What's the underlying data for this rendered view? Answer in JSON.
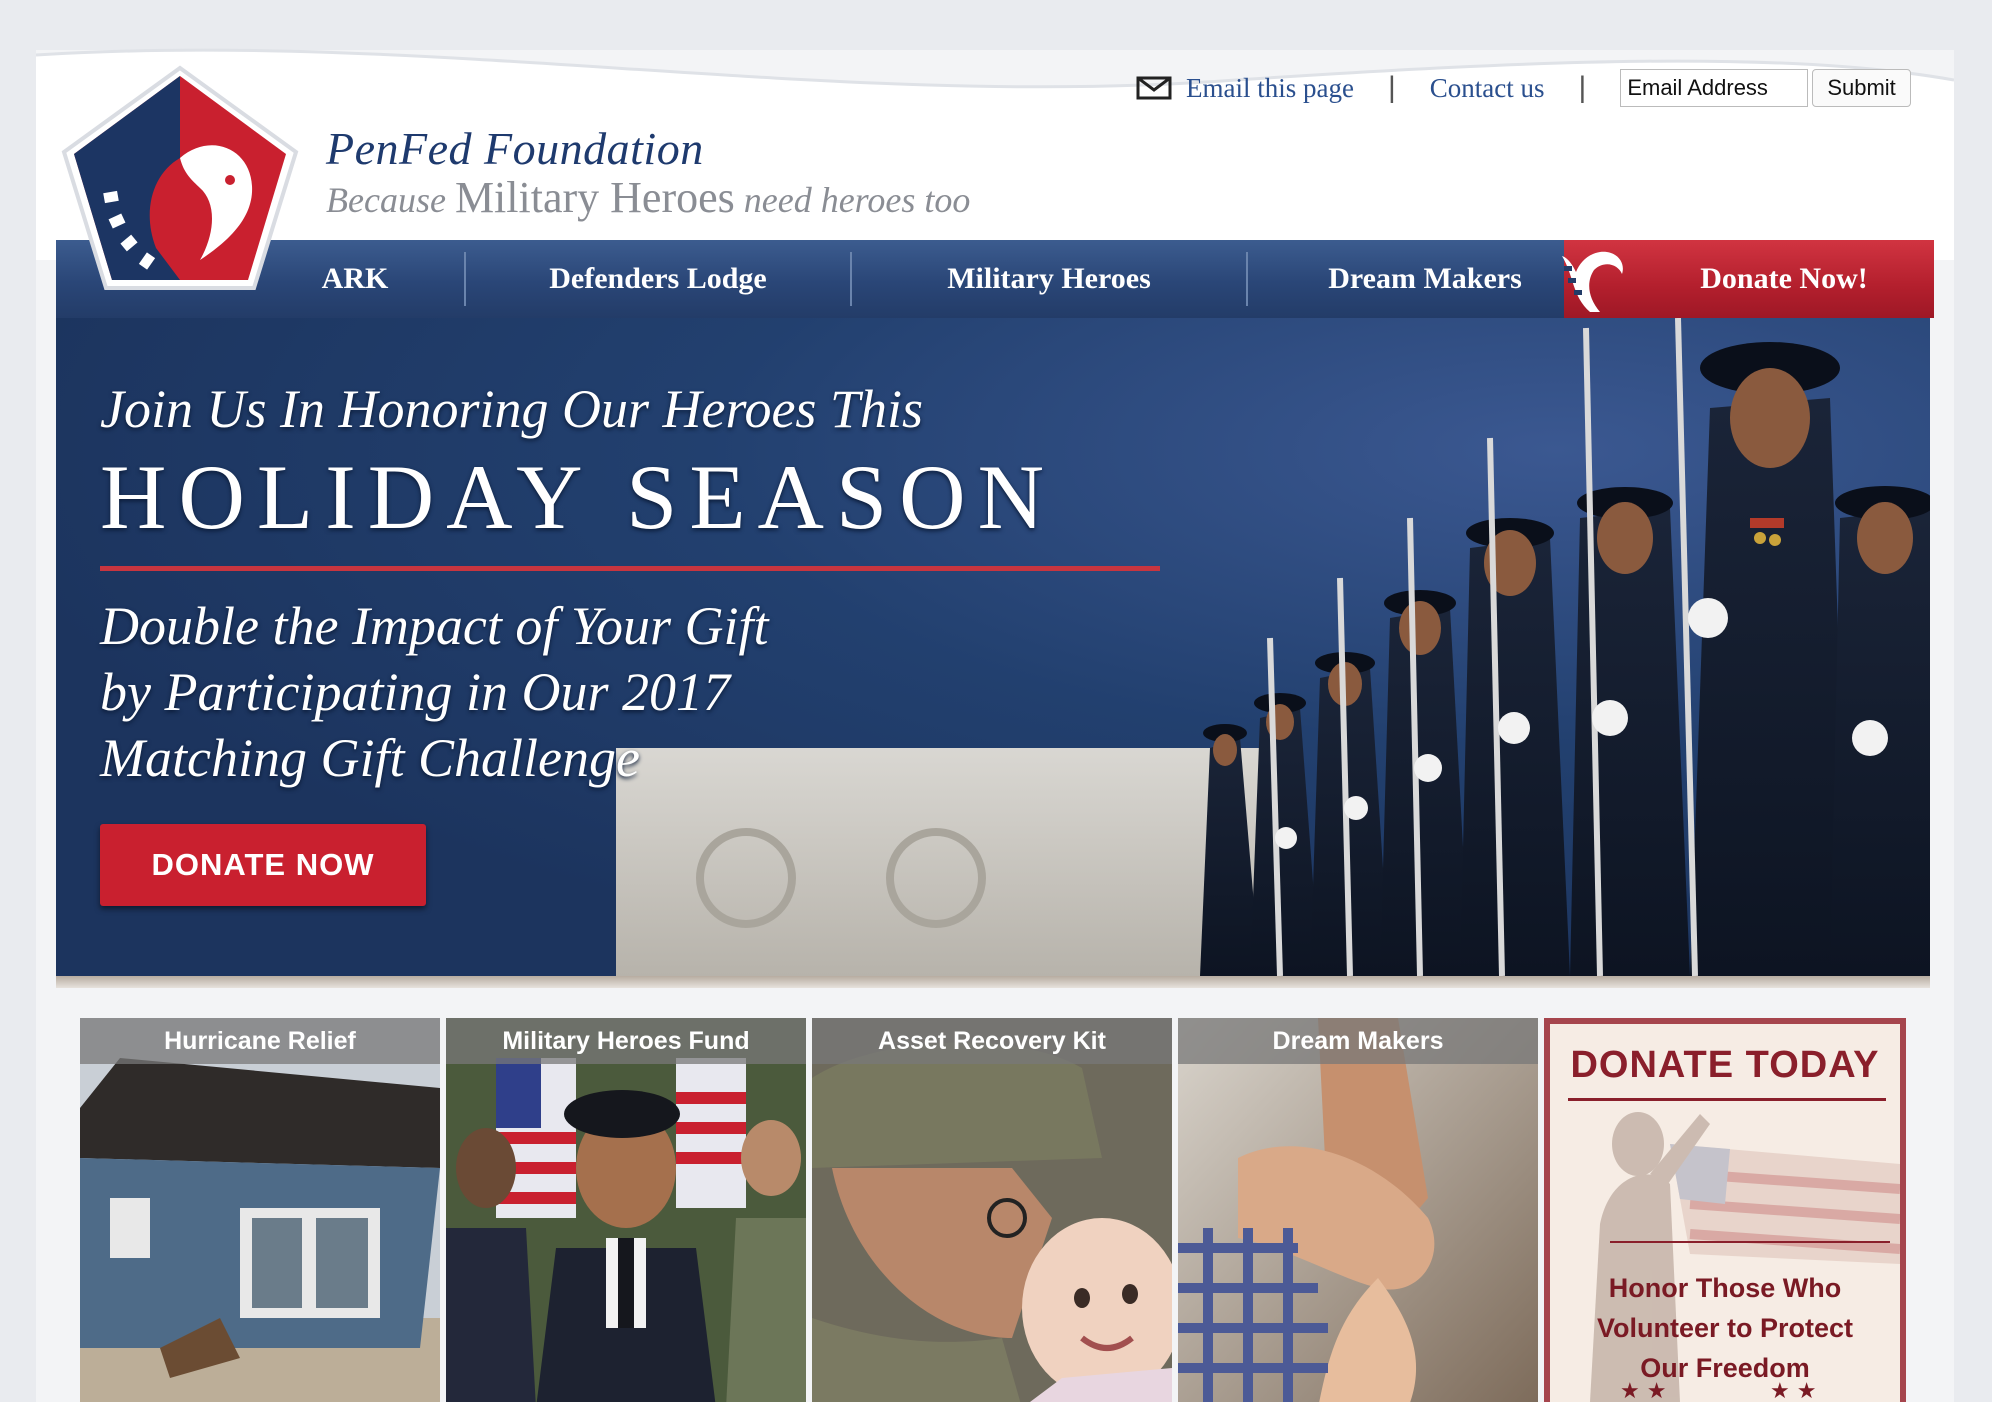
{
  "header": {
    "brand_name": "PenFed Foundation",
    "tagline_pre": "Because",
    "tagline_main": "Military Heroes",
    "tagline_post": "need heroes too"
  },
  "utility": {
    "email_page_label": "Email this page",
    "contact_label": "Contact us",
    "separator": "|",
    "email_placeholder": "Email Address",
    "submit_label": "Submit"
  },
  "nav": {
    "items": [
      {
        "label": "ARK"
      },
      {
        "label": "Defenders Lodge"
      },
      {
        "label": "Military Heroes"
      },
      {
        "label": "Dream Makers"
      }
    ],
    "donate_label": "Donate Now!"
  },
  "hero": {
    "line1": "Join Us In Honoring Our Heroes This",
    "line2": "HOLIDAY SEASON",
    "sub1": "Double the Impact of Your Gift",
    "sub2": "by Participating in Our 2017",
    "sub3": "Matching Gift Challenge",
    "cta_label": "DONATE NOW"
  },
  "tiles": [
    {
      "label": "Hurricane Relief"
    },
    {
      "label": "Military Heroes Fund"
    },
    {
      "label": "Asset Recovery Kit"
    },
    {
      "label": "Dream Makers"
    }
  ],
  "donate_tile": {
    "title": "DONATE TODAY",
    "line1": "Honor Those Who",
    "line2": "Volunteer to Protect",
    "line3": "Our Freedom"
  },
  "colors": {
    "navy": "#233c68",
    "red": "#c9202f",
    "link": "#2a4f8e"
  }
}
